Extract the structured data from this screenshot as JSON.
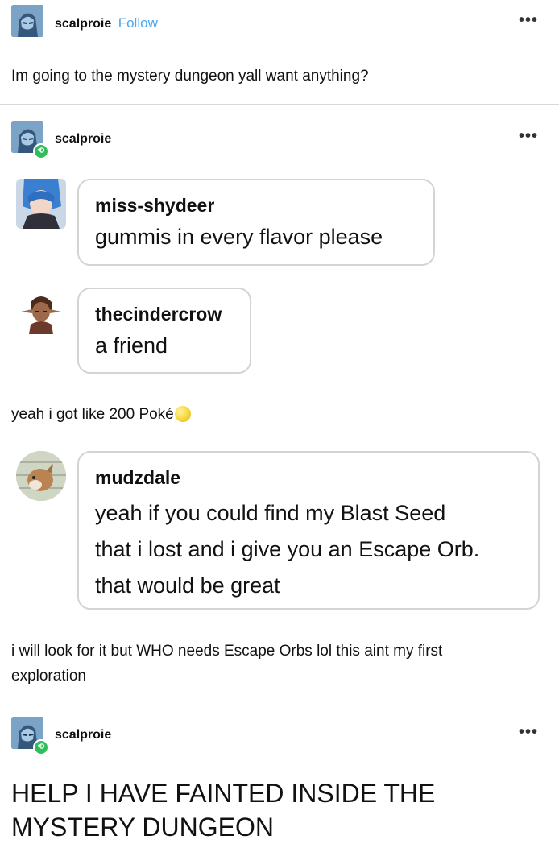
{
  "post1": {
    "username": "scalproie",
    "follow_label": "Follow",
    "more_label": "•••",
    "text": "Im going to the mystery dungeon yall want anything?"
  },
  "post2": {
    "username": "scalproie",
    "more_label": "•••",
    "messages": [
      {
        "name": "miss-shydeer",
        "text": "gummis in every flavor please"
      },
      {
        "name": "thecindercrow",
        "text": "a friend"
      }
    ],
    "reply1": "yeah i got like 200 Poké",
    "messages2": [
      {
        "name": "mudzdale",
        "lines": [
          "yeah if you could find my Blast Seed",
          "that i lost and i give you an Escape Orb.",
          "that would be great"
        ]
      }
    ],
    "reply2_lines": [
      "i will look for it but WHO needs Escape Orbs lol this aint my first",
      "exploration"
    ]
  },
  "post3": {
    "username": "scalproie",
    "more_label": "•••",
    "headline_lines": [
      "HELP I HAVE FAINTED INSIDE THE",
      "MYSTERY DUNGEON"
    ]
  },
  "icons": {
    "more": "more-horizontal-icon",
    "reblog": "reblog-icon",
    "coin": "poke-coin-icon"
  },
  "colors": {
    "follow": "#4aa7f0",
    "reblog_badge": "#2fbf5a",
    "bubble_border": "#d4d4d4",
    "divider": "#d8d8d8"
  }
}
